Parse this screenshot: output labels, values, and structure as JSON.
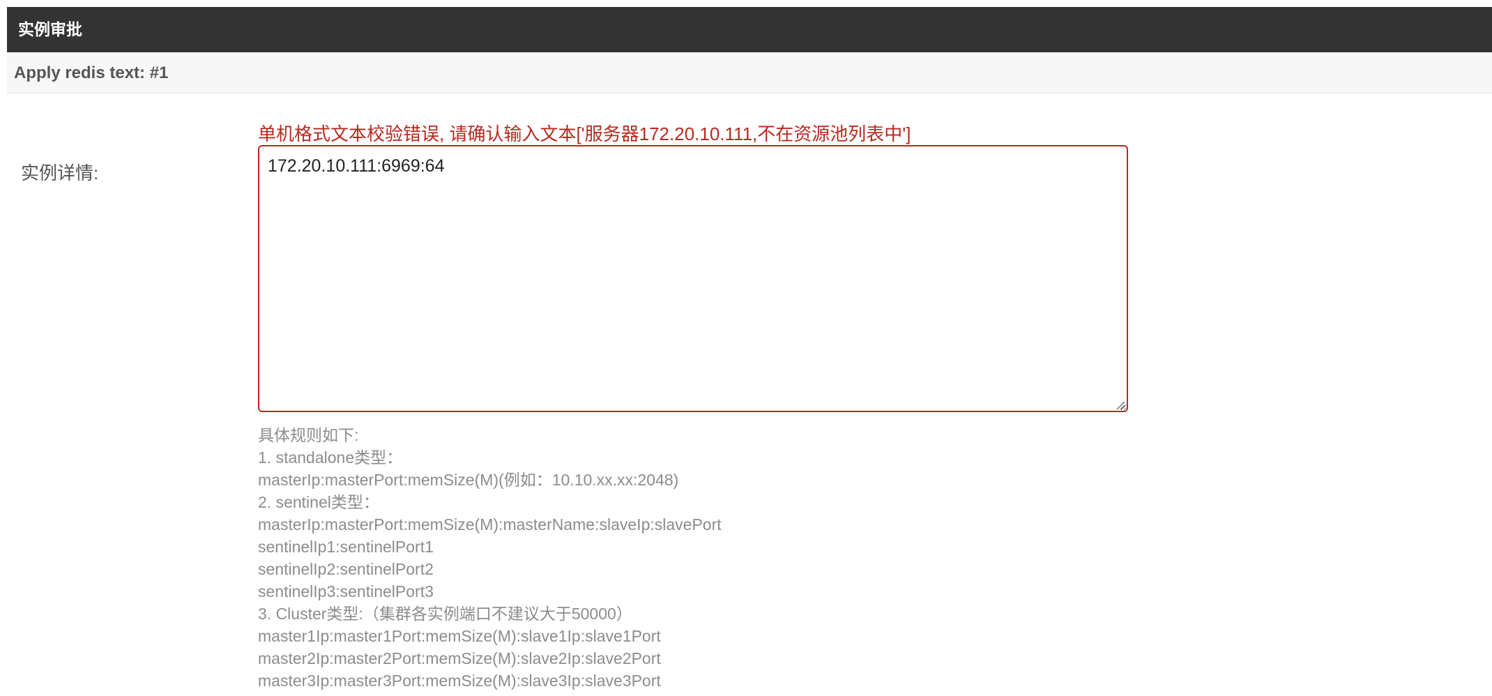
{
  "panel": {
    "title": "实例审批",
    "subtitle": "Apply redis text: #1"
  },
  "form": {
    "error_message": "单机格式文本校验错误, 请确认输入文本['服务器172.20.10.111,不在资源池列表中']",
    "label": "实例详情:",
    "textarea_value": "172.20.10.111:6969:64",
    "help_lines": [
      "具体规则如下:",
      "1. standalone类型：",
      "masterIp:masterPort:memSize(M)(例如：10.10.xx.xx:2048)",
      "2. sentinel类型：",
      "masterIp:masterPort:memSize(M):masterName:slaveIp:slavePort",
      "sentinelIp1:sentinelPort1",
      "sentinelIp2:sentinelPort2",
      "sentinelIp3:sentinelPort3",
      "3. Cluster类型:（集群各实例端口不建议大于50000）",
      "master1Ip:master1Port:memSize(M):slave1Ip:slave1Port",
      "master2Ip:master2Port:memSize(M):slave2Ip:slave2Port",
      "master3Ip:master3Port:memSize(M):slave3Ip:slave3Port"
    ]
  },
  "colors": {
    "header_bg": "#333333",
    "error": "#b8291f",
    "help_text": "#8c8c8c"
  }
}
